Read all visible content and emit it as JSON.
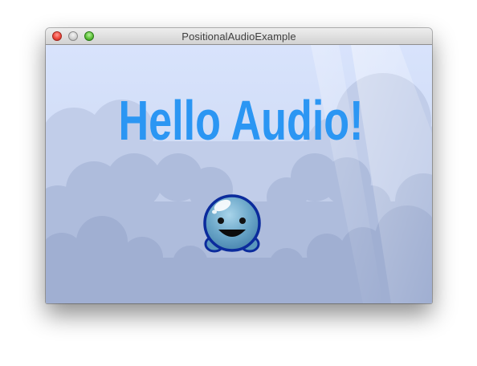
{
  "window": {
    "title": "PositionalAudioExample"
  },
  "scene": {
    "headline": "Hello Audio!",
    "character": "blue-blob-character",
    "colors": {
      "sky_top": "#d6e2fb",
      "sky_bottom": "#c8d5ee",
      "cloud_back": "#b8c5e2",
      "cloud_mid": "#a9b7d7",
      "cloud_front": "#9eadd0",
      "headline": "#2b96f3",
      "blob_body": "#6aa6c8",
      "blob_outline": "#0b2b9c"
    }
  }
}
